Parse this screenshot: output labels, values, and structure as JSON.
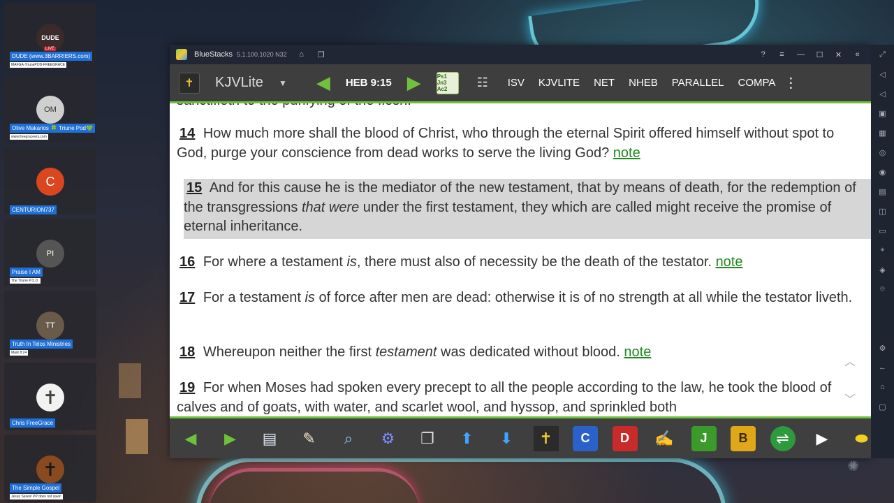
{
  "participants": [
    {
      "name": "DUDE (www.3BARRIERS.com)",
      "sub": "MAFGA-TriunePOD-FREEGRACE",
      "avatar": "DUDE",
      "avatar_color": "#3a2a2a",
      "live": "LIVE"
    },
    {
      "name": "Olive Makarios 🍀 Triune Pod💚",
      "sub": "www.freegraceers.com",
      "avatar": "OM",
      "avatar_color": "#cfcfcf"
    },
    {
      "name": "CENTURION737",
      "sub": "",
      "avatar": "C",
      "avatar_color": "#d9461f"
    },
    {
      "name": "Praise I AM",
      "sub": "The Triune P.O.D.",
      "avatar": "PI",
      "avatar_color": "#555"
    },
    {
      "name": "Truth In Telos Ministries",
      "sub": "Mark 8:24",
      "avatar": "TT",
      "avatar_color": "#6a5a4a"
    },
    {
      "name": "Chris FreeGrace",
      "sub": "",
      "avatar": "✝",
      "avatar_color": "#f2f2f2"
    },
    {
      "name": "The Simple Gospel",
      "sub": "Jesus Saves! PP does not save!",
      "avatar": "✝",
      "avatar_color": "#8a4a20"
    }
  ],
  "window": {
    "title": "BlueStacks",
    "version": "5.1.100.1020  N32"
  },
  "toolbar": {
    "app_name": "KJVLite",
    "dropdown_icon": "▼",
    "verse_ref": "HEB 9:15",
    "translations": [
      "ISV",
      "KJVLITE",
      "NET",
      "NHEB",
      "PARALLEL",
      "COMPA"
    ],
    "icon1_text": "Ps1 Jn3 Ac2"
  },
  "content": {
    "cutoff_text": "sanctifieth to the purifying of the flesh:",
    "verses": [
      {
        "num": "14",
        "text": "How much more shall the blood of Christ, who through the eternal Spirit offered himself without spot to God, purge your conscience from dead works to serve the living God?",
        "note": "note"
      },
      {
        "num": "15",
        "text_a": "And for this cause he is the mediator of the new testament, that by means of death, for the redemption of the transgressions ",
        "italic": "that were",
        "text_b": " under the first testament, they which are called might receive the promise of eternal inheritance."
      },
      {
        "num": "16",
        "text_a": "For where a testament ",
        "italic": "is",
        "text_b": ", there must also of necessity be the death of the testator.",
        "note": "note"
      },
      {
        "num": "17",
        "text_a": "For a testament ",
        "italic": "is",
        "text_b": " of force after men are dead: otherwise it is of no strength at all while the testator liveth."
      },
      {
        "num": "18",
        "text_a": "Whereupon neither the first ",
        "italic": "testament",
        "text_b": " was dedicated without blood.",
        "note": "note"
      },
      {
        "num": "19",
        "text": "For when Moses had spoken every precept to all the people according to the law, he took the blood of calves and of goats, with water, and scarlet wool, and hyssop, and sprinkled both"
      }
    ]
  },
  "bottombar": {
    "letters": [
      "C",
      "D",
      "J",
      "B"
    ]
  },
  "colors": {
    "accent_green": "#6ec23a",
    "note_green": "#1f8a1f",
    "highlight": "#d6d6d6"
  }
}
